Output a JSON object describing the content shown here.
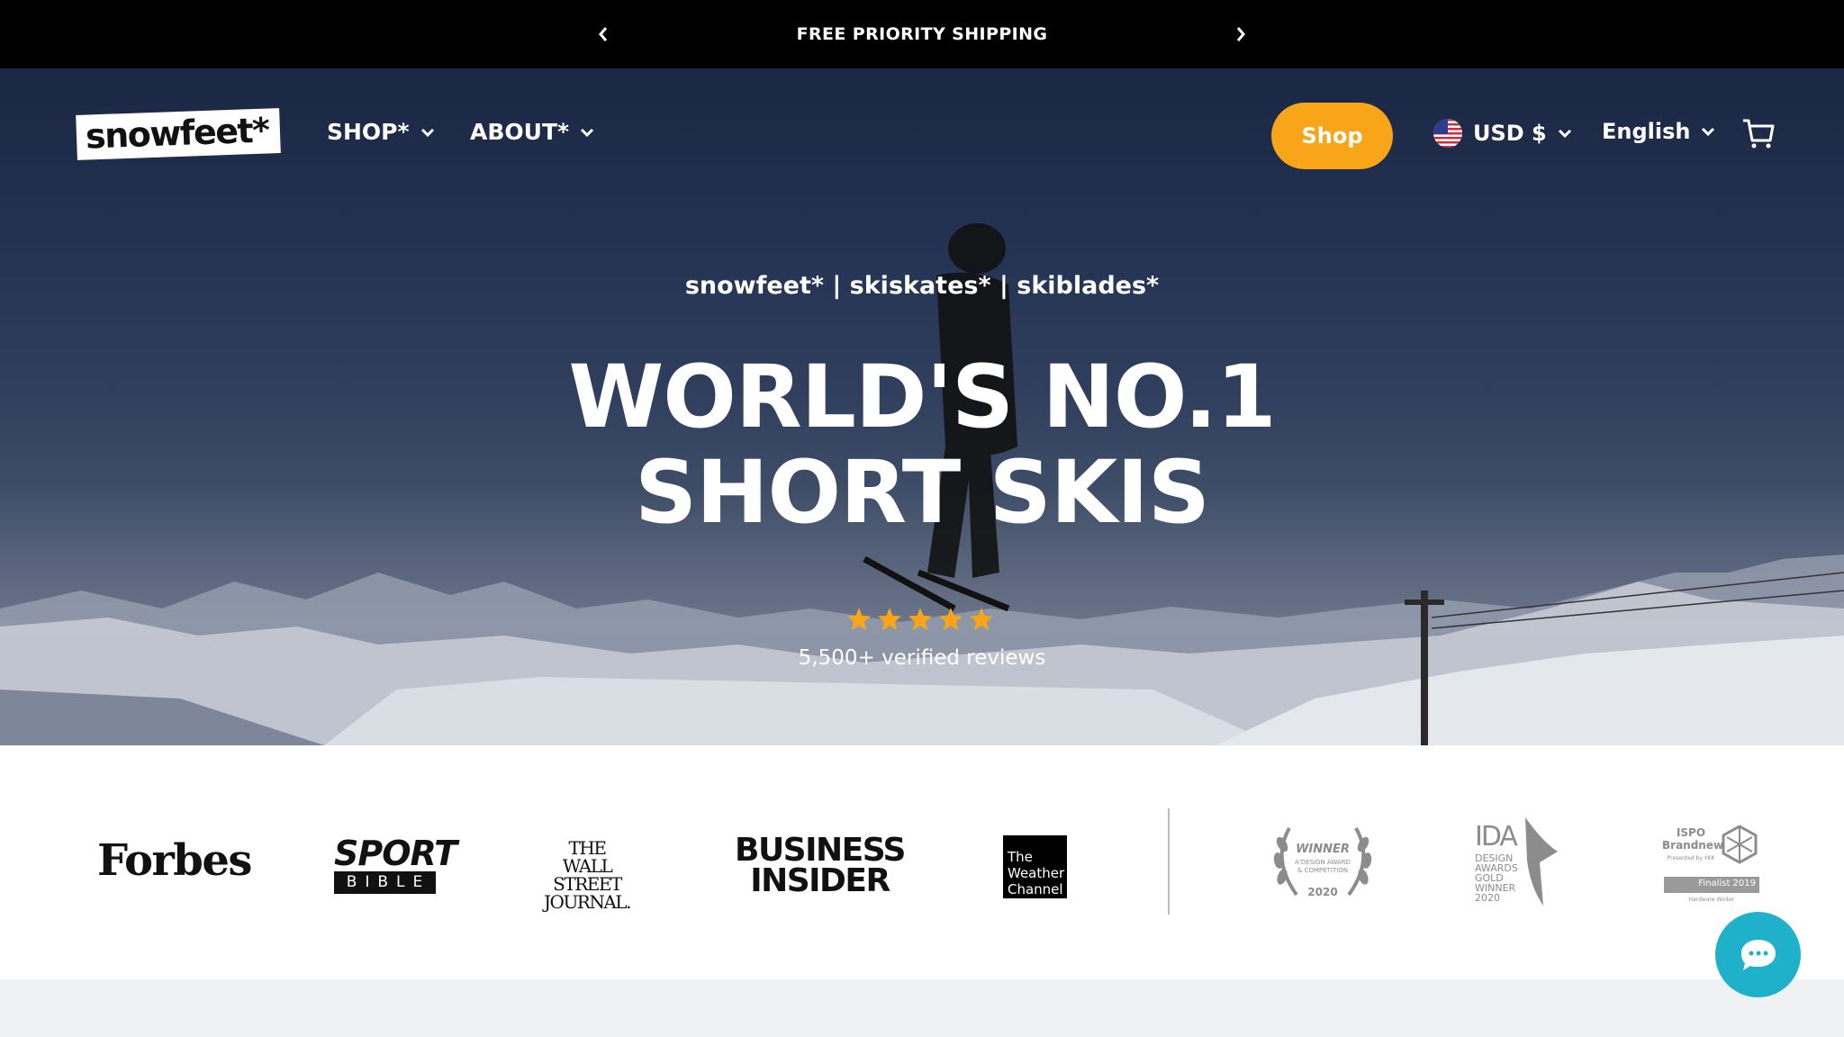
{
  "announcement": {
    "text": "FREE PRIORITY SHIPPING",
    "prev_icon": "chevron-left-icon",
    "next_icon": "chevron-right-icon"
  },
  "header": {
    "logo_text": "snowfeet*",
    "nav": [
      {
        "label": "SHOP*"
      },
      {
        "label": "ABOUT*"
      }
    ],
    "shop_button": "Shop",
    "currency": "USD $",
    "language": "English",
    "cart_icon": "cart-icon"
  },
  "hero": {
    "subtitle": "snowfeet* | skiskates* | skiblades*",
    "title_line1": "WORLD'S NO.1",
    "title_line2": "SHORT SKIS",
    "rating_stars": 5,
    "reviews": "5,500+ verified reviews"
  },
  "press": {
    "logos": {
      "forbes": "Forbes",
      "sportbible_top": "SPORT",
      "sportbible_bottom": "BIBLE",
      "wsj_line1": "THE",
      "wsj_line2": "WALL STREET",
      "wsj_line3": "JOURNAL.",
      "bi_line1": "BUSINESS",
      "bi_line2": "INSIDER",
      "weather_line1": "The",
      "weather_line2": "Weather",
      "weather_line3": "Channel"
    },
    "awards": {
      "winner_title": "WINNER",
      "winner_sub1": "A'DESIGN AWARD",
      "winner_sub2": "& COMPETITION",
      "winner_year": "2020",
      "ida_title": "IDA",
      "ida_line1": "DESIGN",
      "ida_line2": "AWARDS",
      "ida_line3": "GOLD",
      "ida_line4": "WINNER",
      "ida_year": "2020",
      "ispo_line1": "ISPO",
      "ispo_line2": "Brandnew",
      "ispo_presented": "Presented by YKK",
      "ispo_finalist": "Finalist 2019",
      "ispo_category": "Hardware Winter"
    }
  },
  "colors": {
    "accent": "#f9a51a",
    "chat": "#1fb1c9",
    "announcement_bg": "#000000"
  }
}
